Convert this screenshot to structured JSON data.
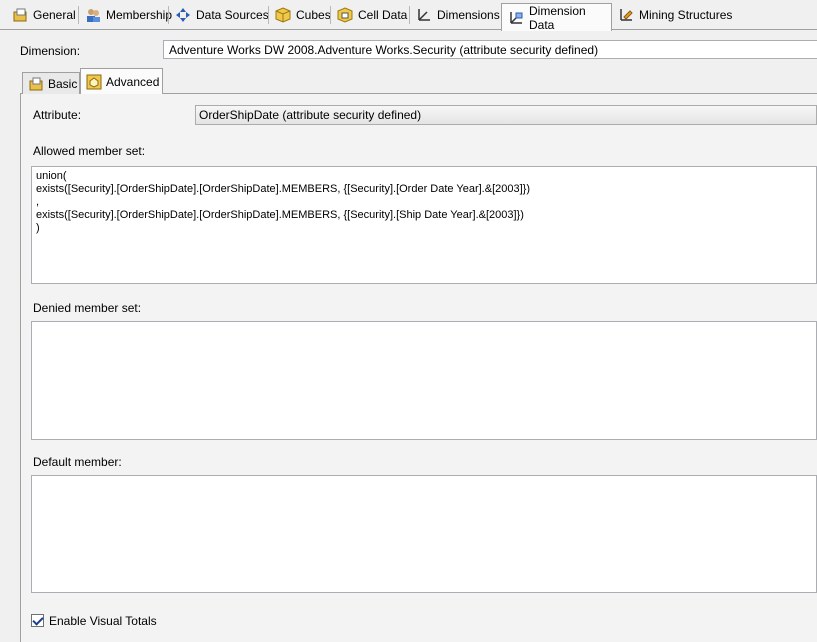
{
  "tabs": [
    {
      "label": "General",
      "icon": "general-icon"
    },
    {
      "label": "Membership",
      "icon": "membership-icon"
    },
    {
      "label": "Data Sources",
      "icon": "data-sources-icon"
    },
    {
      "label": "Cubes",
      "icon": "cube-icon"
    },
    {
      "label": "Cell Data",
      "icon": "cell-data-icon"
    },
    {
      "label": "Dimensions",
      "icon": "dimensions-icon"
    },
    {
      "label": "Dimension Data",
      "icon": "dimension-data-icon"
    },
    {
      "label": "Mining Structures",
      "icon": "mining-structures-icon"
    }
  ],
  "active_tab": "Dimension Data",
  "dimension": {
    "label": "Dimension:",
    "value": "Adventure Works DW 2008.Adventure Works.Security (attribute security defined)"
  },
  "inner_tabs": [
    {
      "label": "Basic",
      "icon": "basic-icon"
    },
    {
      "label": "Advanced",
      "icon": "advanced-icon"
    }
  ],
  "active_inner_tab": "Advanced",
  "attribute": {
    "label": "Attribute:",
    "value": "OrderShipDate (attribute security defined)"
  },
  "allowed": {
    "label": "Allowed member set:",
    "value": "union(\nexists([Security].[OrderShipDate].[OrderShipDate].MEMBERS, {[Security].[Order Date Year].&[2003]})\n,\nexists([Security].[OrderShipDate].[OrderShipDate].MEMBERS, {[Security].[Ship Date Year].&[2003]})\n)"
  },
  "denied": {
    "label": "Denied member set:",
    "value": ""
  },
  "default_member": {
    "label": "Default member:",
    "value": ""
  },
  "visual_totals": {
    "label": "Enable Visual Totals",
    "checked": true
  },
  "colors": {
    "background": "#f0f0f0",
    "border": "#a0a0a0",
    "check": "#1c3f8c"
  }
}
